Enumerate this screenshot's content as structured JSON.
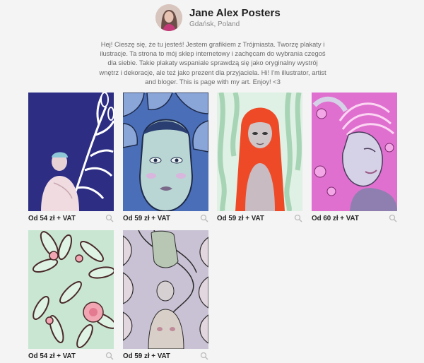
{
  "shop": {
    "name": "Jane Alex Posters",
    "location": "Gdańsk, Poland",
    "bio": "Hej! Cieszę się, że tu jesteś! Jestem grafikiem z Trójmiasta. Tworzę plakaty i ilustracje. Ta strona to mój sklep internetowy i zachęcam do wybrania czegoś dla siebie. Takie plakaty wspaniale sprawdzą się jako oryginalny wystrój wnętrz i dekoracje, ale też jako prezent dla przyjaciela. Hi! I'm illustrator, artist and bloger. This is page with my art. Enjoy! <3"
  },
  "posters": [
    {
      "price": "Od 54 zł + VAT",
      "icon": "zoom-icon",
      "palette": [
        "#2c2d83",
        "#e8d2d6",
        "#ffffff"
      ]
    },
    {
      "price": "Od 59 zł + VAT",
      "icon": "zoom-icon",
      "palette": [
        "#4a6fb8",
        "#b9d6d4",
        "#1e2a4a"
      ]
    },
    {
      "price": "Od 59 zł + VAT",
      "icon": "zoom-icon",
      "palette": [
        "#a7d4b4",
        "#ef4a27",
        "#c8bcc2"
      ]
    },
    {
      "price": "Od 60 zł + VAT",
      "icon": "zoom-icon",
      "palette": [
        "#e070cf",
        "#8f7fb0",
        "#d5d1e6"
      ]
    },
    {
      "price": "Od 54 zł + VAT",
      "icon": "zoom-icon",
      "palette": [
        "#c9e6d2",
        "#4a2a2a",
        "#f2a6b4"
      ]
    },
    {
      "price": "Od 59 zł + VAT",
      "icon": "zoom-icon",
      "palette": [
        "#c9c1d4",
        "#2a2a2a",
        "#e3d7df"
      ]
    }
  ]
}
